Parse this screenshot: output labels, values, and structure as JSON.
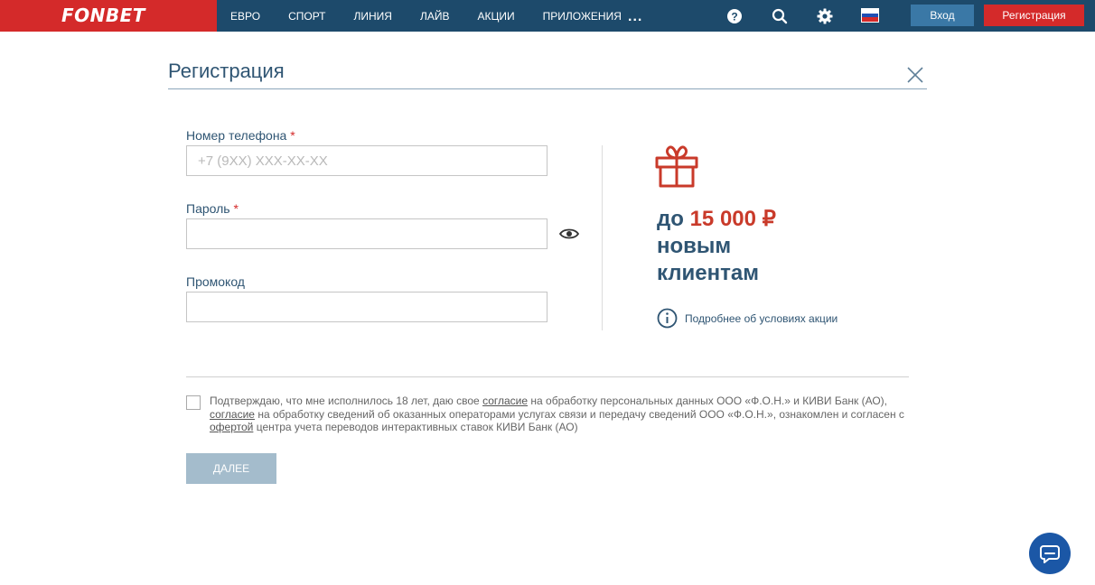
{
  "header": {
    "logo": "FONBET",
    "nav": [
      "ЕВРО",
      "СПОРТ",
      "ЛИНИЯ",
      "ЛАЙВ",
      "АКЦИИ",
      "ПРИЛОЖЕНИЯ"
    ],
    "more": "...",
    "login_label": "Вход",
    "register_label": "Регистрация",
    "icons": [
      "help-icon",
      "search-icon",
      "gear-icon",
      "russia-flag-icon"
    ],
    "colors": {
      "bar": "#1d4a6b",
      "brand_red": "#d42a2a",
      "login_button": "#3a78a6"
    }
  },
  "modal": {
    "title": "Регистрация",
    "phone": {
      "label": "Номер телефона",
      "required": "*",
      "placeholder": "+7 (9XX) XXX-XX-XX",
      "value": ""
    },
    "password": {
      "label": "Пароль",
      "required": "*",
      "value": ""
    },
    "promo": {
      "label": "Промокод",
      "value": ""
    },
    "bonus": {
      "prefix": "до",
      "amount": "15 000 ₽",
      "line2": "новым",
      "line3": "клиентам",
      "link": "Подробнее об условиях акции"
    },
    "consent": {
      "checked": false,
      "t1": "Подтверждаю, что мне исполнилось 18 лет, даю свое ",
      "l1": "согласие",
      "t2": " на обработку персональных данных ООО «Ф.О.Н.» и КИВИ Банк (АО), ",
      "l2": "согласие",
      "t3": " на обработку сведений об оказанных операторами услугах связи и передачу сведений ООО «Ф.О.Н.», ознакомлен и согласен с ",
      "l3": "офертой",
      "t4": " центра учета переводов интерактивных ставок КИВИ Банк (АО)"
    },
    "next_label": "ДАЛЕЕ",
    "colors": {
      "accent_text": "#2f5573",
      "amount": "#c93a2a",
      "next_button": "#a4bccc"
    }
  },
  "chat": {
    "icon": "chat-icon",
    "color": "#1b57a6"
  }
}
